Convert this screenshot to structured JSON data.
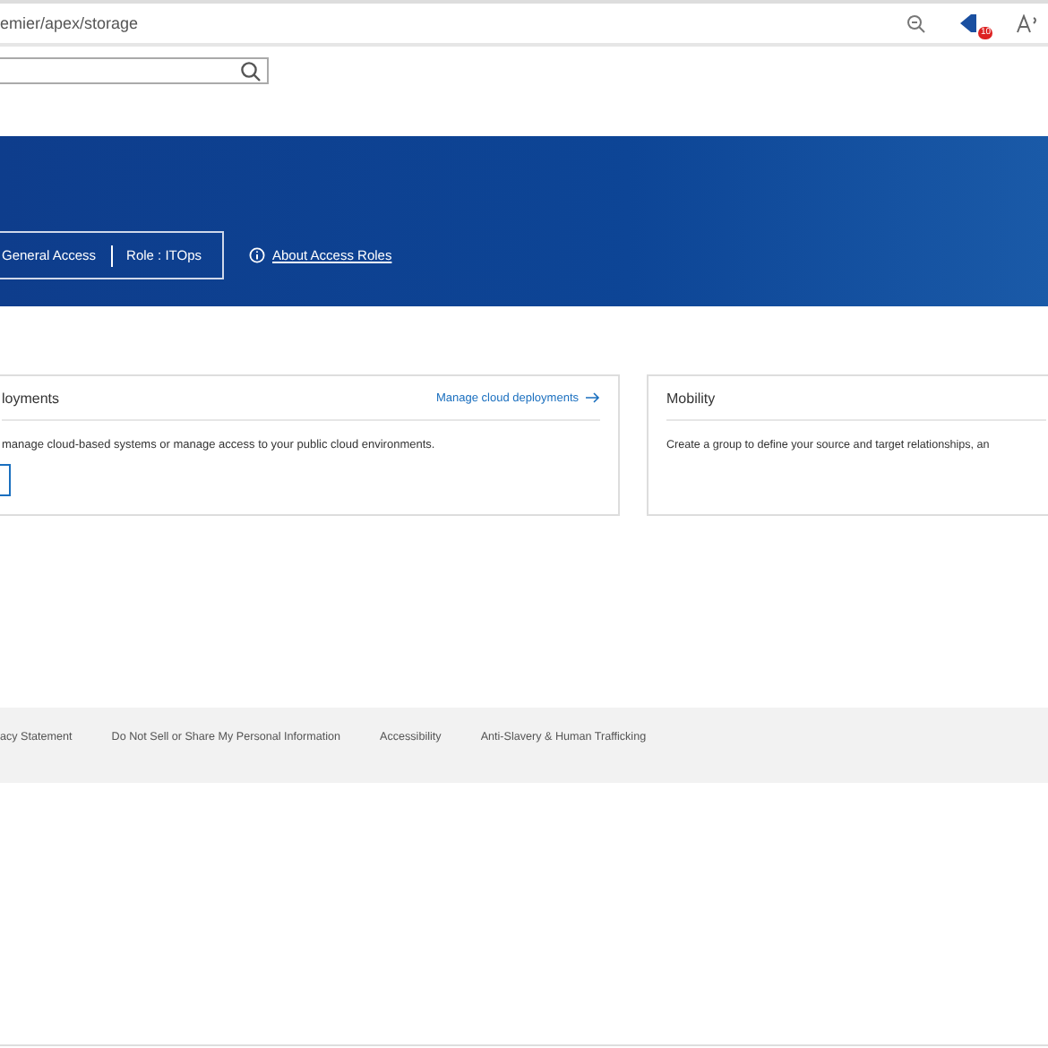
{
  "address_bar": {
    "url": "emier/apex/storage",
    "notification_count": "10"
  },
  "banner": {
    "access": "General Access",
    "role": "Role : ITOps",
    "about_link": "About Access Roles"
  },
  "cards": [
    {
      "title": "loyments",
      "link": "Manage cloud deployments",
      "text": "manage cloud-based systems or manage access to your public cloud environments.",
      "has_button": true
    },
    {
      "title": "Mobility",
      "text": "Create a group to define your source and target relationships, an",
      "has_button": false
    }
  ],
  "footer": {
    "links": [
      "acy Statement",
      "Do Not Sell or Share My Personal Information",
      "Accessibility",
      "Anti-Slavery & Human Trafficking"
    ]
  }
}
